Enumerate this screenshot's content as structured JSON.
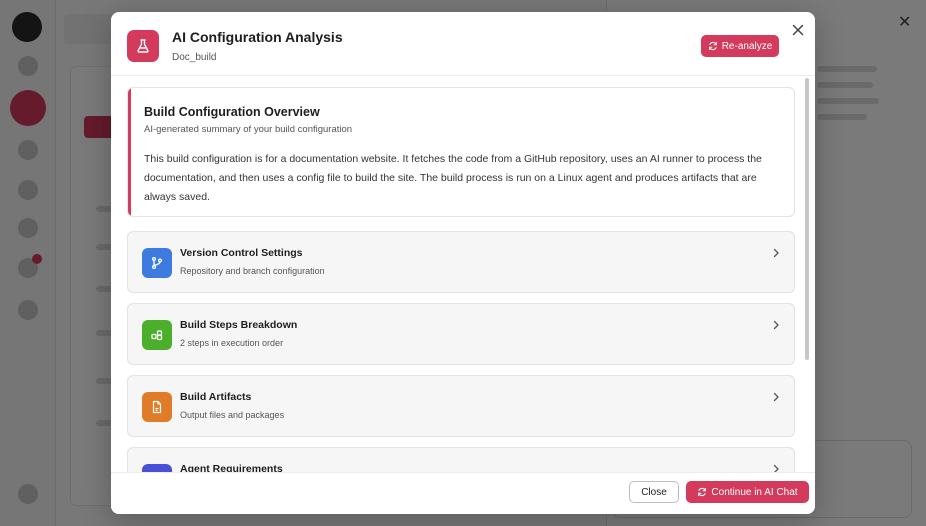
{
  "modal": {
    "title": "AI Configuration Analysis",
    "subtitle": "Doc_build",
    "reanalyze_label": "Re-analyze",
    "close_icon": "close-icon"
  },
  "overview": {
    "title": "Build Configuration Overview",
    "subtitle": "AI-generated summary of your build configuration",
    "text": "This build configuration is for a documentation website. It fetches the code from a GitHub repository, uses an AI runner to process the documentation, and then uses a config file to build the site. The build process is run on a Linux agent and produces artifacts that are always saved."
  },
  "sections": [
    {
      "title": "Version Control Settings",
      "subtitle": "Repository and branch configuration",
      "icon": "branch-icon",
      "color": "#3d7be0"
    },
    {
      "title": "Build Steps Breakdown",
      "subtitle": "2 steps in execution order",
      "icon": "steps-icon",
      "color": "#4caf2b"
    },
    {
      "title": "Build Artifacts",
      "subtitle": "Output files and packages",
      "icon": "file-icon",
      "color": "#e07b28"
    },
    {
      "title": "Agent Requirements",
      "subtitle": "",
      "icon": "agent-icon",
      "color": "#4a4fd8"
    }
  ],
  "footer": {
    "close_label": "Close",
    "continue_label": "Continue in AI Chat"
  },
  "colors": {
    "accent": "#d43a5c"
  }
}
